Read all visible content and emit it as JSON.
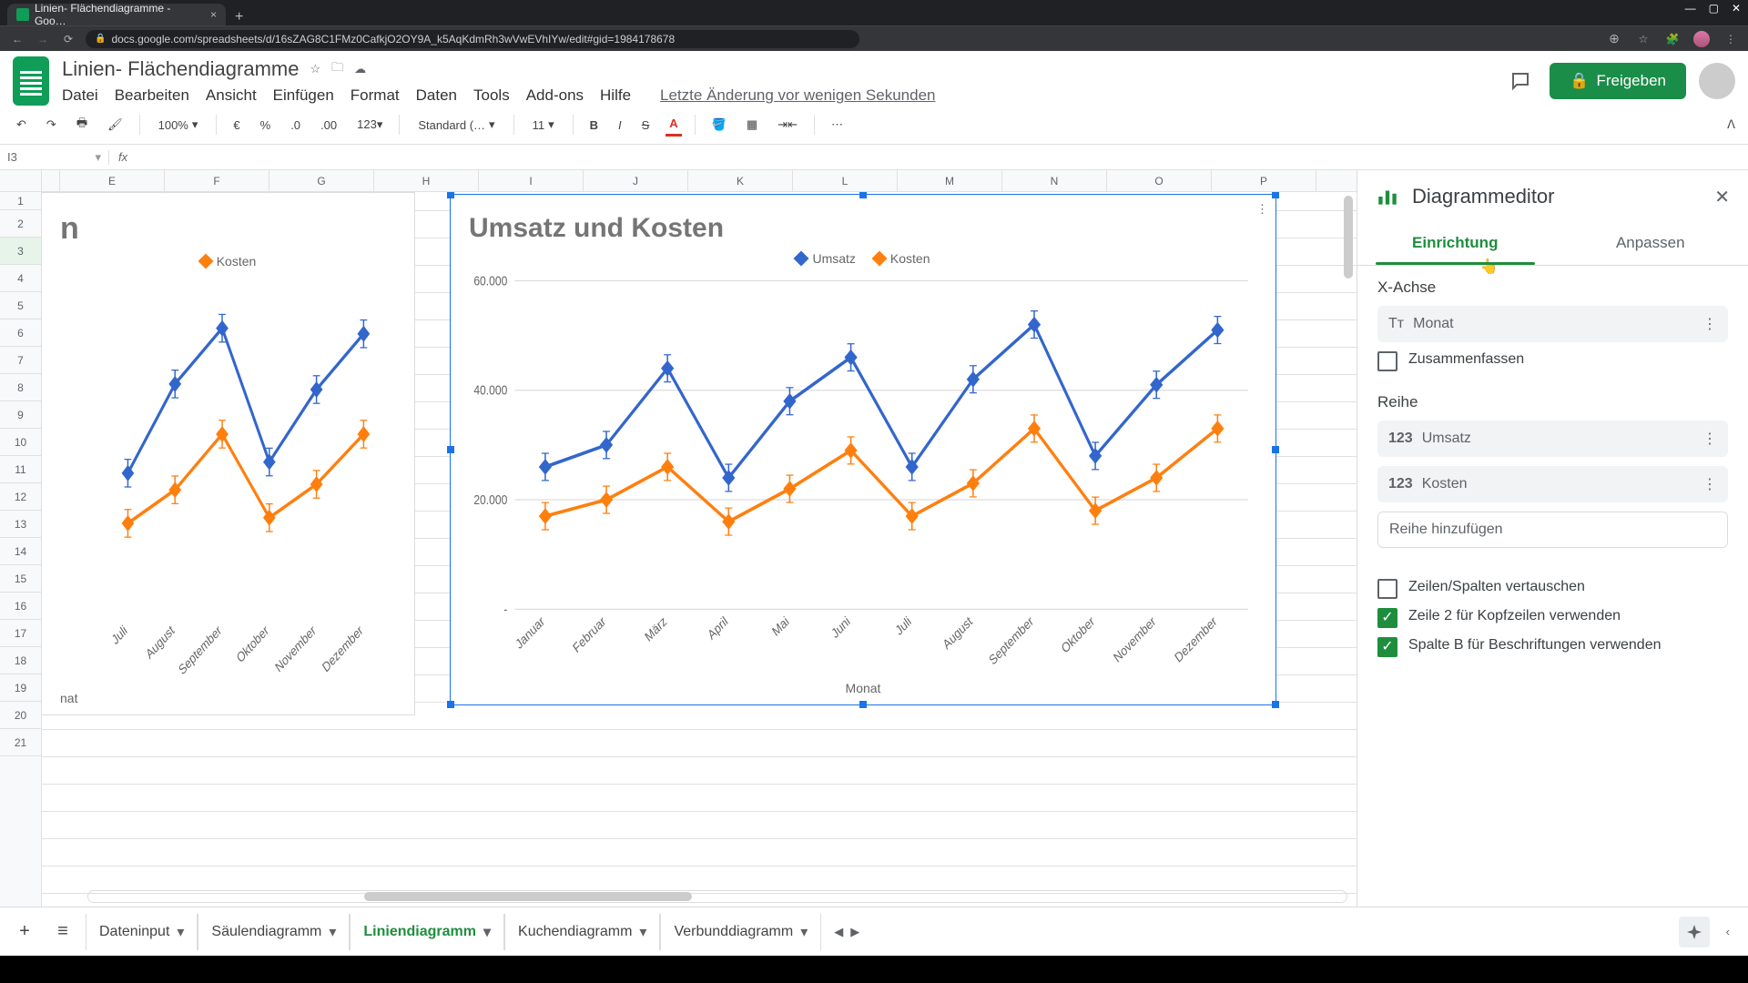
{
  "browser": {
    "tab_title": "Linien- Flächendiagramme - Goo…",
    "url": "docs.google.com/spreadsheets/d/16sZAG8C1FMz0CafkjO2OY9A_k5AqKdmRh3wVwEVhIYw/edit#gid=1984178678"
  },
  "doc": {
    "title": "Linien- Flächendiagramme",
    "last_edit": "Letzte Änderung vor wenigen Sekunden",
    "share_label": "Freigeben"
  },
  "menus": [
    "Datei",
    "Bearbeiten",
    "Ansicht",
    "Einfügen",
    "Format",
    "Daten",
    "Tools",
    "Add-ons",
    "Hilfe"
  ],
  "toolbar": {
    "zoom": "100%",
    "font": "Standard (…",
    "size": "11",
    "number_fmt": "123"
  },
  "formula": {
    "cell": "I3",
    "value": ""
  },
  "columns": [
    "E",
    "F",
    "G",
    "H",
    "I",
    "J",
    "K",
    "L",
    "M",
    "N",
    "O",
    "P"
  ],
  "rows_visible": 21,
  "left_chart": {
    "legend_item": "Kosten",
    "xlabel_partial": "nat",
    "title_partial": "n",
    "categories": [
      "Juli",
      "August",
      "September",
      "Oktober",
      "November",
      "Dezember"
    ]
  },
  "chart_data": {
    "type": "line",
    "title": "Umsatz und Kosten",
    "xlabel": "Monat",
    "ylabel": "",
    "ylim": [
      0,
      60000
    ],
    "categories": [
      "Januar",
      "Februar",
      "März",
      "April",
      "Mai",
      "Juni",
      "Juli",
      "August",
      "September",
      "Oktober",
      "November",
      "Dezember"
    ],
    "y_ticks": [
      {
        "v": 60000,
        "label": "60.000"
      },
      {
        "v": 40000,
        "label": "40.000"
      },
      {
        "v": 20000,
        "label": "20.000"
      },
      {
        "v": 0,
        "label": "-"
      }
    ],
    "series": [
      {
        "name": "Umsatz",
        "color": "#3366cc",
        "values": [
          26000,
          30000,
          44000,
          24000,
          38000,
          46000,
          26000,
          42000,
          52000,
          28000,
          41000,
          51000
        ]
      },
      {
        "name": "Kosten",
        "color": "#ff7f0e",
        "values": [
          17000,
          20000,
          26000,
          16000,
          22000,
          29000,
          17000,
          23000,
          33000,
          18000,
          24000,
          33000
        ]
      }
    ]
  },
  "sidebar": {
    "title": "Diagrammeditor",
    "tabs": {
      "setup": "Einrichtung",
      "customize": "Anpassen"
    },
    "xaxis_label": "X-Achse",
    "xaxis_value": "Monat",
    "aggregate": "Zusammenfassen",
    "series_label": "Reihe",
    "series": [
      "Umsatz",
      "Kosten"
    ],
    "add_series": "Reihe hinzufügen",
    "switch": "Zeilen/Spalten vertauschen",
    "header_row": "Zeile 2 für Kopfzeilen verwenden",
    "labels_col": "Spalte B für Beschriftungen verwenden"
  },
  "sheets": {
    "tabs": [
      "Dateninput",
      "Säulendiagramm",
      "Liniendiagramm",
      "Kuchendiagramm",
      "Verbunddiagramm"
    ],
    "active": "Liniendiagramm"
  }
}
